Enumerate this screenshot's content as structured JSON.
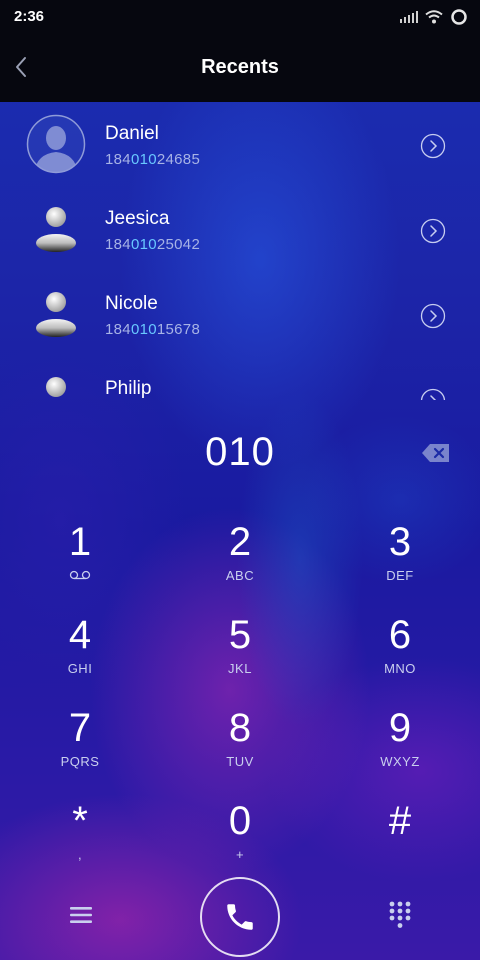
{
  "status_bar": {
    "time": "2:36",
    "icons": [
      "signal-icon",
      "wifi-icon",
      "battery-ring-icon"
    ]
  },
  "header": {
    "title": "Recents",
    "back_icon": "chevron-left-icon"
  },
  "recents": [
    {
      "name": "Daniel",
      "number_prefix": "184",
      "number_match": "010",
      "number_suffix": "24685",
      "avatar": "profile-silhouette-icon"
    },
    {
      "name": "Jeesica",
      "number_prefix": "184",
      "number_match": "010",
      "number_suffix": "25042",
      "avatar": "person-icon"
    },
    {
      "name": "Nicole",
      "number_prefix": "184",
      "number_match": "010",
      "number_suffix": "15678",
      "avatar": "person-icon"
    },
    {
      "name": "Philip",
      "number_prefix": "",
      "number_match": "",
      "number_suffix": "",
      "avatar": "person-icon"
    }
  ],
  "dialer": {
    "input_value": "010",
    "keys": [
      {
        "digit": "1",
        "letters": "",
        "icon": "voicemail-icon"
      },
      {
        "digit": "2",
        "letters": "ABC"
      },
      {
        "digit": "3",
        "letters": "DEF"
      },
      {
        "digit": "4",
        "letters": "GHI"
      },
      {
        "digit": "5",
        "letters": "JKL"
      },
      {
        "digit": "6",
        "letters": "MNO"
      },
      {
        "digit": "7",
        "letters": "PQRS"
      },
      {
        "digit": "8",
        "letters": "TUV"
      },
      {
        "digit": "9",
        "letters": "WXYZ"
      },
      {
        "digit": "*",
        "letters": ","
      },
      {
        "digit": "0",
        "letters": "+"
      },
      {
        "digit": "#",
        "letters": ""
      }
    ]
  },
  "bottom_bar": {
    "left_icon": "menu-icon",
    "center_icon": "phone-icon",
    "right_icon": "dialpad-icon"
  },
  "colors": {
    "highlight": "#69c8ff",
    "number_text": "#a7b3e6",
    "header_bg": "#06070f"
  }
}
